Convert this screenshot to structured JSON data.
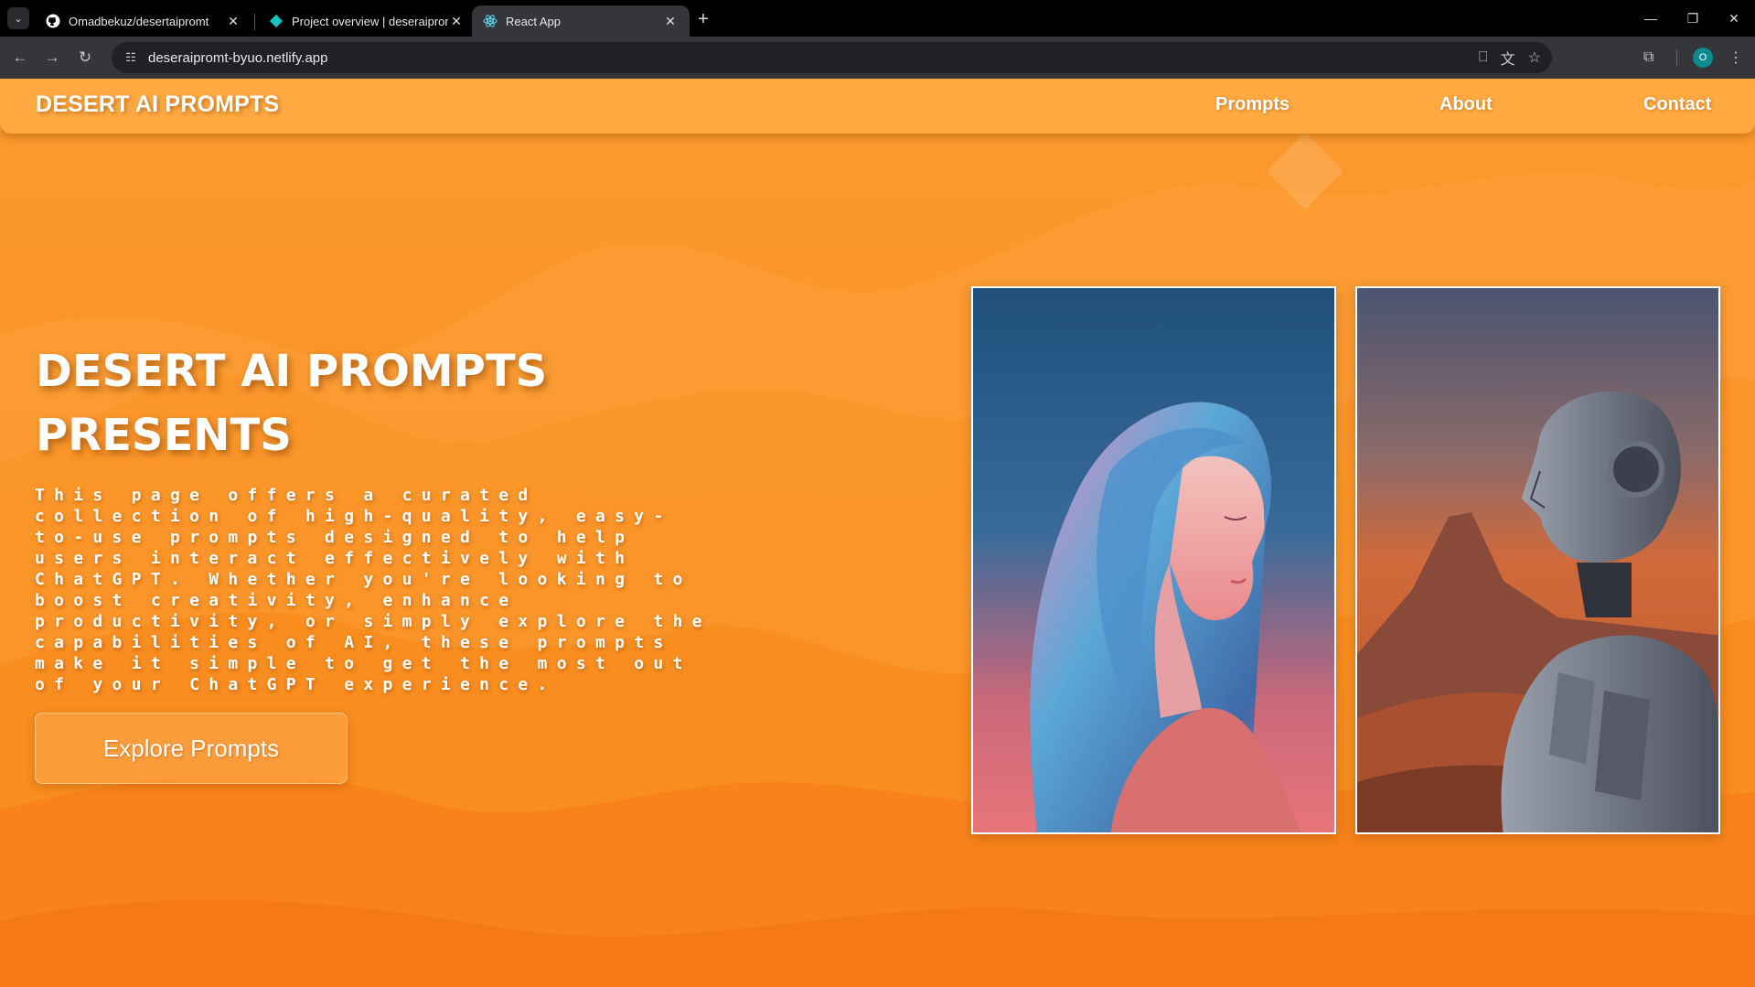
{
  "browser": {
    "tabs": [
      {
        "title": "Omadbekuz/desertaipromt",
        "icon": "github-icon",
        "active": false
      },
      {
        "title": "Project overview | deseraipromt",
        "icon": "netlify-icon",
        "active": false
      },
      {
        "title": "React App",
        "icon": "react-icon",
        "active": true
      }
    ],
    "url": "deseraipromt-byuo.netlify.app",
    "profile_initial": "O"
  },
  "site": {
    "logo": "DESERT AI PROMPTS",
    "nav": {
      "prompts": "Prompts",
      "about": "About",
      "contact": "Contact"
    }
  },
  "hero": {
    "title_line1": "DESERT AI PROMPTS",
    "title_line2": "PRESENTS",
    "description_lines": [
      "This page offers a curated",
      "collection of high-quality, easy-",
      "to-use prompts designed to help",
      "users interact effectively with",
      "ChatGPT. Whether you're looking to",
      "boost creativity, enhance",
      "productivity, or simply explore the",
      "capabilities of AI, these prompts",
      "make it simple to get the most out",
      "of your ChatGPT experience."
    ],
    "cta_label": "Explore Prompts"
  },
  "colors": {
    "header_bg": "#ffa940",
    "page_bg": "#fb9326",
    "text": "#ffffff"
  }
}
